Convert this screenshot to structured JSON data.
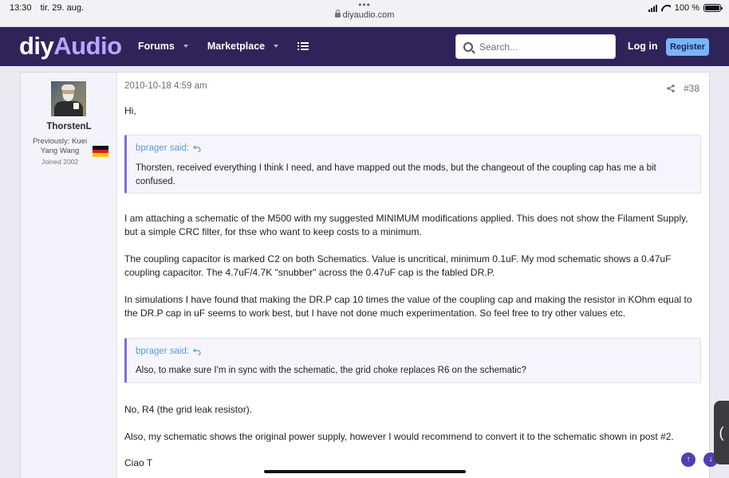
{
  "status_bar": {
    "time": "13:30",
    "date": "tir. 29. aug.",
    "url": "diyaudio.com",
    "battery": "100 %",
    "battery_level": 1.0
  },
  "header": {
    "logo_part1": "diy",
    "logo_part2": "Audio",
    "nav": [
      "Forums",
      "Marketplace"
    ],
    "search_placeholder": "Search...",
    "login": "Log in",
    "register": "Register"
  },
  "post": {
    "user": {
      "name": "ThorstenL",
      "title": "Previously: Kuei Yang Wang",
      "joined": "Joined 2002",
      "country_flag": "germany-flag"
    },
    "date": "2010-10-18 4:59 am",
    "number": "#38",
    "greeting": "Hi,",
    "quote1": {
      "author": "bprager said:",
      "text": "Thorsten, received everything I think I need, and have mapped out the mods, but the changeout of the coupling cap has me a bit confused."
    },
    "paragraphs": [
      "I am attaching a schematic of the M500 with my suggested MINIMUM modifications applied. This does not show the Filament Supply, but a simple CRC filter, for thse who want to keep costs to a minimum.",
      "The coupling capacitor is marked C2 on both Schematics. Value is uncritical, minimum 0.1uF. My mod schematic shows a 0.47uF coupling capacitor. The 4.7uF/4.7K \"snubber\" across the 0.47uF cap is the fabled DR.P.",
      "In simulations I have found that making the DR.P cap 10 times the value of the coupling cap and making the resistor in KOhm equal to the DR.P cap in uF seems to work best, but I have not done much experimentation. So feel free to try other values etc."
    ],
    "quote2": {
      "author": "bprager said:",
      "text": "Also, to make sure I'm in sync with the schematic, the grid choke replaces R6 on the schematic?"
    },
    "reply_paragraphs": [
      "No, R4 (the grid leak resistor).",
      "Also, my schematic shows the original power supply, however I would recommend to convert it to the schematic shown in post #2.",
      "Ciao T"
    ]
  },
  "controls": {
    "scroll_up": "↑",
    "scroll_down": "↓",
    "side_tab": "("
  }
}
